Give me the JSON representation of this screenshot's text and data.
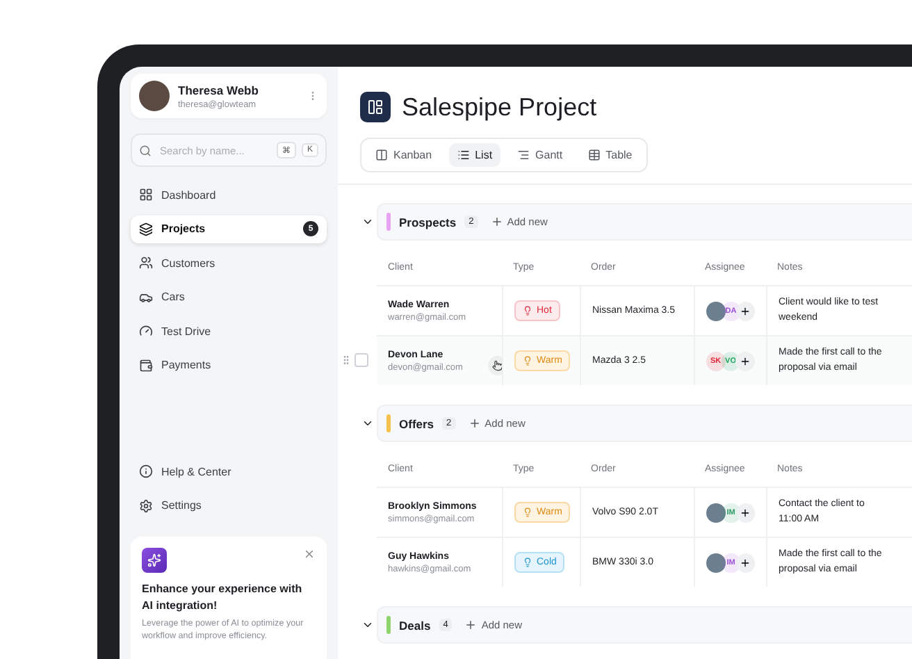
{
  "profile": {
    "name": "Theresa Webb",
    "email": "theresa@glowteam"
  },
  "search": {
    "placeholder": "Search by name...",
    "keys": [
      "⌘",
      "K"
    ]
  },
  "nav": [
    {
      "label": "Dashboard",
      "selected": false
    },
    {
      "label": "Projects",
      "selected": true,
      "badge": "5"
    },
    {
      "label": "Customers",
      "selected": false
    },
    {
      "label": "Cars",
      "selected": false
    },
    {
      "label": "Test Drive",
      "selected": false
    },
    {
      "label": "Payments",
      "selected": false
    }
  ],
  "bottom_nav": [
    {
      "label": "Help & Center"
    },
    {
      "label": "Settings"
    }
  ],
  "promo": {
    "title": "Enhance your experience with AI integration!",
    "text": "Leverage the power of AI to optimize your workflow and improve efficiency."
  },
  "project": {
    "title": "Salespipe Project"
  },
  "tabs": [
    {
      "label": "Kanban",
      "selected": false
    },
    {
      "label": "List",
      "selected": true
    },
    {
      "label": "Gantt",
      "selected": false
    },
    {
      "label": "Table",
      "selected": false
    }
  ],
  "sections": [
    {
      "title": "Prospects",
      "count": "2",
      "color": "#e9a3f2",
      "expanded": true,
      "add_label": "Add new",
      "columns": [
        "Client",
        "Type",
        "Order",
        "Assignee",
        "Notes"
      ],
      "rows": [
        {
          "name": "Wade Warren",
          "email": "warren@gmail.com",
          "type": {
            "label": "Hot",
            "kind": "hot"
          },
          "order": "Nissan Maxima 3.5",
          "assignees": [
            {
              "kind": "photo"
            },
            {
              "kind": "initials",
              "text": "DA",
              "color": "#9b4fd6"
            }
          ],
          "notes": [
            "Client would like to test",
            "weekend"
          ],
          "hovered": false
        },
        {
          "name": "Devon Lane",
          "email": "devon@gmail.com",
          "type": {
            "label": "Warm",
            "kind": "warm"
          },
          "order": "Mazda 3 2.5",
          "assignees": [
            {
              "kind": "initials",
              "text": "SK",
              "color": "#e0283a"
            },
            {
              "kind": "initials",
              "text": "VO",
              "color": "#1fa562"
            }
          ],
          "notes": [
            "Made the first call to the",
            "proposal via email"
          ],
          "hovered": true,
          "checked": false
        }
      ]
    },
    {
      "title": "Offers",
      "count": "2",
      "color": "#f6c04c",
      "expanded": true,
      "add_label": "Add new",
      "columns": [
        "Client",
        "Type",
        "Order",
        "Assignee",
        "Notes"
      ],
      "rows": [
        {
          "name": "Brooklyn Simmons",
          "email": "simmons@gmail.com",
          "type": {
            "label": "Warm",
            "kind": "warm"
          },
          "order": "Volvo S90 2.0T",
          "assignees": [
            {
              "kind": "photo"
            },
            {
              "kind": "initials",
              "text": "IM",
              "color": "#2a9a64"
            }
          ],
          "notes": [
            "Contact the client to",
            "11:00 AM"
          ],
          "hovered": false
        },
        {
          "name": "Guy Hawkins",
          "email": "hawkins@gmail.com",
          "type": {
            "label": "Cold",
            "kind": "cold"
          },
          "order": "BMW 330i 3.0",
          "assignees": [
            {
              "kind": "photo"
            },
            {
              "kind": "initials",
              "text": "IM",
              "color": "#9b4fd6"
            }
          ],
          "notes": [
            "Made the first call to the",
            "proposal via email"
          ],
          "hovered": false
        }
      ]
    },
    {
      "title": "Deals",
      "count": "4",
      "color": "#8ed36b",
      "expanded": true,
      "add_label": "Add new"
    }
  ]
}
